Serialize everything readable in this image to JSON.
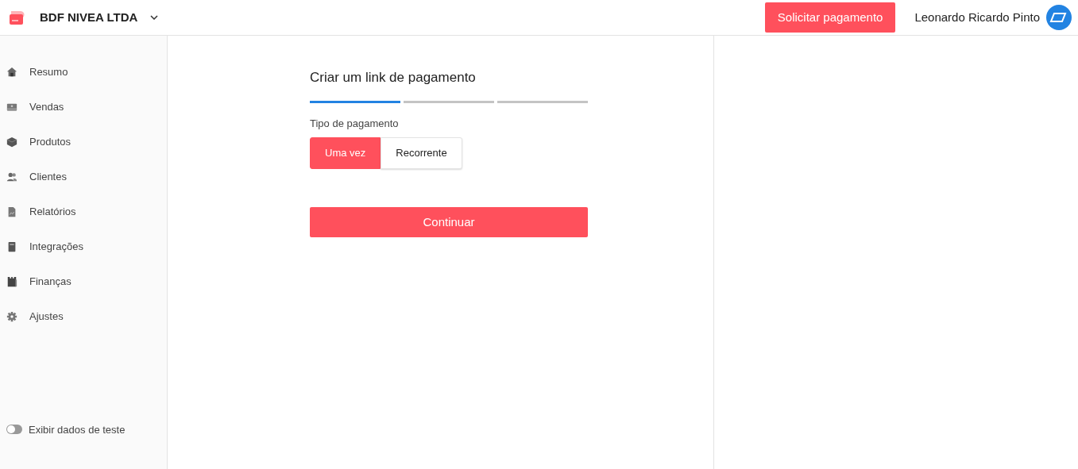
{
  "header": {
    "company": "BDF NIVEA LTDA",
    "action_button": "Solicitar pagamento",
    "user_name": "Leonardo Ricardo Pinto"
  },
  "sidebar": {
    "items": [
      {
        "kind": "home",
        "label": "Resumo",
        "selected": false
      },
      {
        "kind": "sales",
        "label": "Vendas",
        "selected": false
      },
      {
        "kind": "box",
        "label": "Produtos",
        "selected": false
      },
      {
        "kind": "people",
        "label": "Clientes",
        "selected": false
      },
      {
        "kind": "report",
        "label": "Relatórios",
        "selected": false
      },
      {
        "kind": "book",
        "label": "Integrações",
        "selected": false
      },
      {
        "kind": "money",
        "label": "Finanças",
        "selected": false
      },
      {
        "kind": "gear",
        "label": "Ajustes",
        "selected": false
      }
    ],
    "test_toggle": {
      "label": "Exibir dados de teste",
      "on": false
    }
  },
  "form": {
    "title": "Criar um link de pagamento",
    "steps": [
      {
        "active": true
      },
      {
        "active": false
      },
      {
        "active": false
      }
    ],
    "payment_type_label": "Tipo de pagamento",
    "payment_types": [
      {
        "label": "Uma vez",
        "selected": true
      },
      {
        "label": "Recorrente",
        "selected": false
      }
    ],
    "continue_button": "Continuar"
  }
}
